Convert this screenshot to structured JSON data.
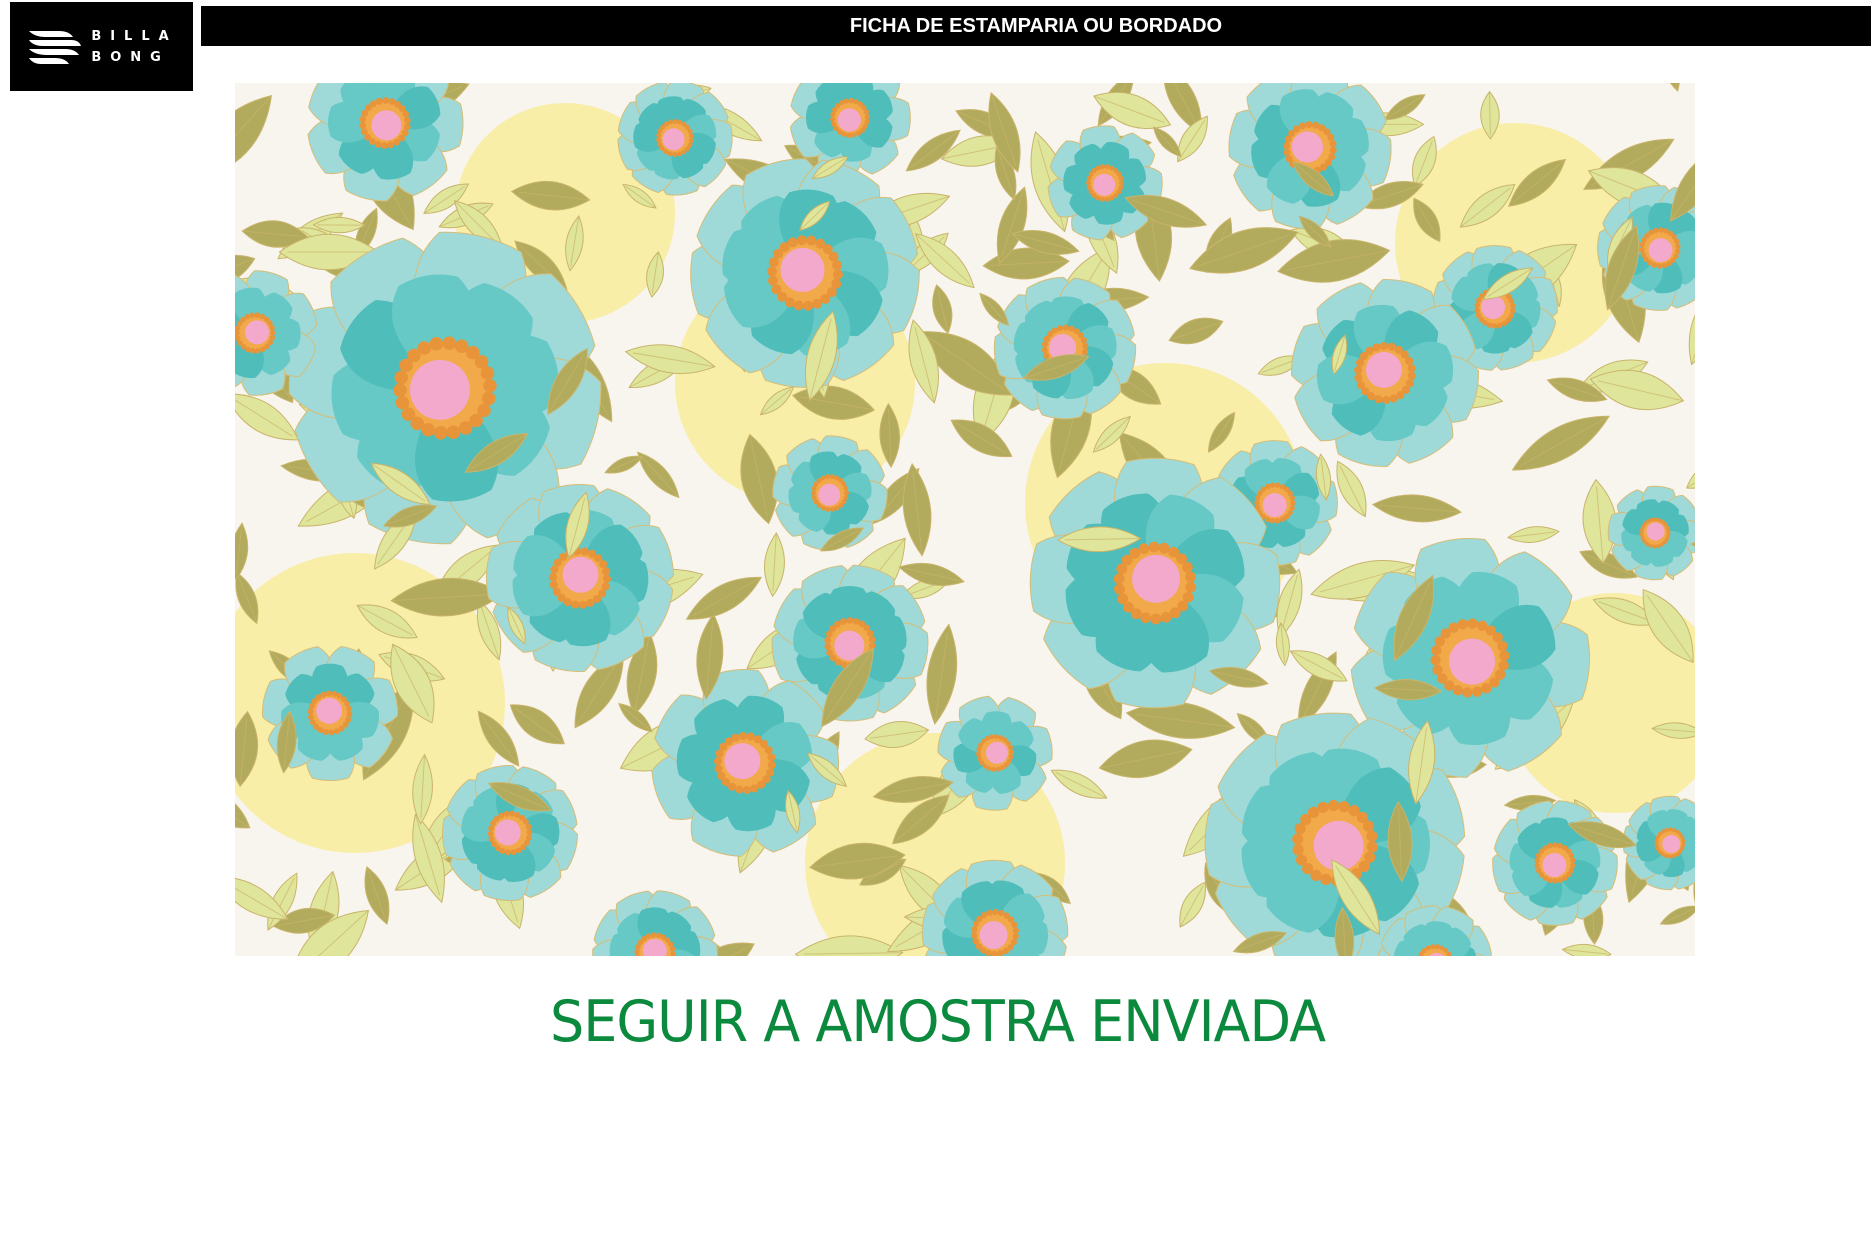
{
  "brand": {
    "logo_lines": [
      "BILLA",
      "BONG"
    ]
  },
  "header": {
    "title": "FICHA DE ESTAMPARIA OU BORDADO"
  },
  "print": {
    "background": "#f8f4ee",
    "palette": {
      "turquoise": "#66c9c6",
      "turquoise_light": "#9fdad8",
      "turquoise_dark": "#4fbdba",
      "leaf_green": "#dfe69b",
      "leaf_olive": "#b2ab5d",
      "sun_yellow": "#f8ed9f",
      "center_orange": "#f2a94a",
      "center_pink": "#f3a9cc"
    }
  },
  "caption": {
    "text": "SEGUIR A AMOSTRA ENVIADA",
    "color": "#0b8a3e"
  }
}
